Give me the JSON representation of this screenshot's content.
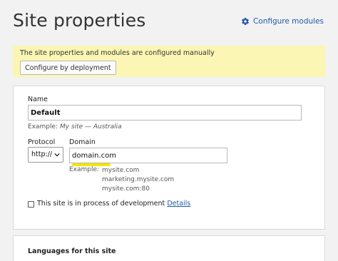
{
  "header": {
    "title": "Site properties",
    "configure_modules_label": "Configure modules"
  },
  "notice": {
    "text": "The site properties and modules are configured manually",
    "button_label": "Configure by deployment"
  },
  "form": {
    "name": {
      "label": "Name",
      "value": "Default",
      "example_prefix": "Example:",
      "example_value": "My site — Australia"
    },
    "protocol": {
      "label": "Protocol",
      "selected": "http://"
    },
    "domain": {
      "label": "Domain",
      "value": "domain.com",
      "example_prefix": "Example:",
      "examples": [
        "mysite.com",
        "marketing.mysite.com",
        "mysite.com:80"
      ]
    },
    "development": {
      "checked": false,
      "label": "This site is in process of development",
      "details_link": "Details"
    }
  },
  "languages": {
    "title": "Languages for this site"
  },
  "colors": {
    "link": "#1f5aa6",
    "notice_bg": "#fbf6b4",
    "highlight": "#f3e600"
  }
}
